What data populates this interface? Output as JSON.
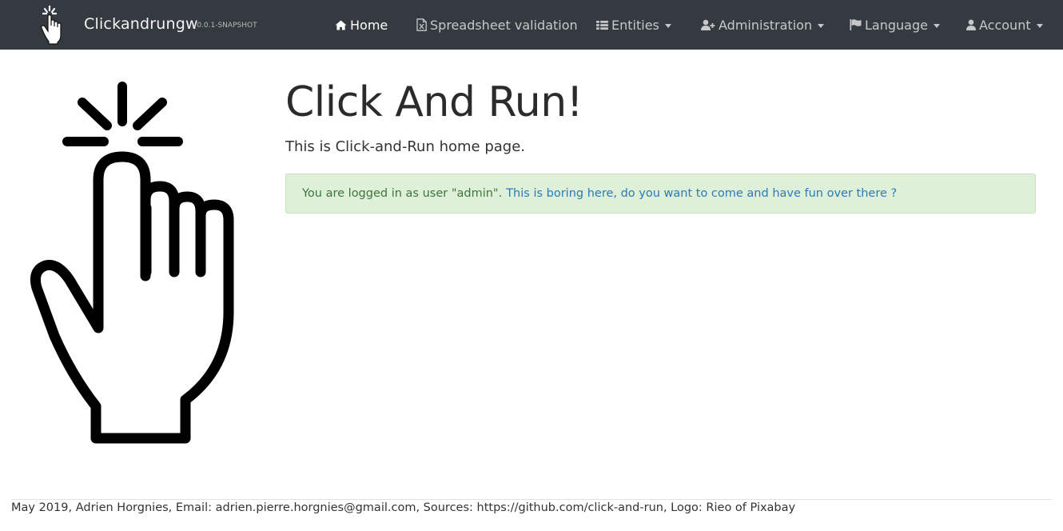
{
  "navbar": {
    "brand_name": "Clickandrungw",
    "brand_version": "v0.0.1-SNAPSHOT",
    "brand_icon": "hand-pointer-icon",
    "items": [
      {
        "label": "Home",
        "icon": "home-icon",
        "active": true,
        "dropdown": false
      },
      {
        "label": "Spreadsheet validation",
        "icon": "file-excel-icon",
        "active": false,
        "dropdown": false
      },
      {
        "label": "Entities",
        "icon": "list-icon",
        "active": false,
        "dropdown": true
      },
      {
        "label": "Administration",
        "icon": "user-plus-icon",
        "active": false,
        "dropdown": true
      },
      {
        "label": "Language",
        "icon": "flag-icon",
        "active": false,
        "dropdown": true
      },
      {
        "label": "Account",
        "icon": "user-icon",
        "active": false,
        "dropdown": true
      }
    ],
    "colors": {
      "background": "#343a40",
      "active_text": "#ffffff",
      "text": "#c6c8ca"
    }
  },
  "main": {
    "logo_icon": "hand-pointer-icon",
    "title": "Click And Run!",
    "lead": "This is Click-and-Run home page.",
    "alert": {
      "text": "You are logged in as user \"admin\".",
      "link_text": "This is boring here, do you want to come and have fun over there ?",
      "background": "#dff0d8",
      "text_color": "#3c763d",
      "link_color": "#2a7ab8"
    }
  },
  "footer": {
    "text": "May 2019, Adrien Horgnies, Email: adrien.pierre.horgnies@gmail.com, Sources: https://github.com/click-and-run, Logo: Rieo of Pixabay"
  }
}
